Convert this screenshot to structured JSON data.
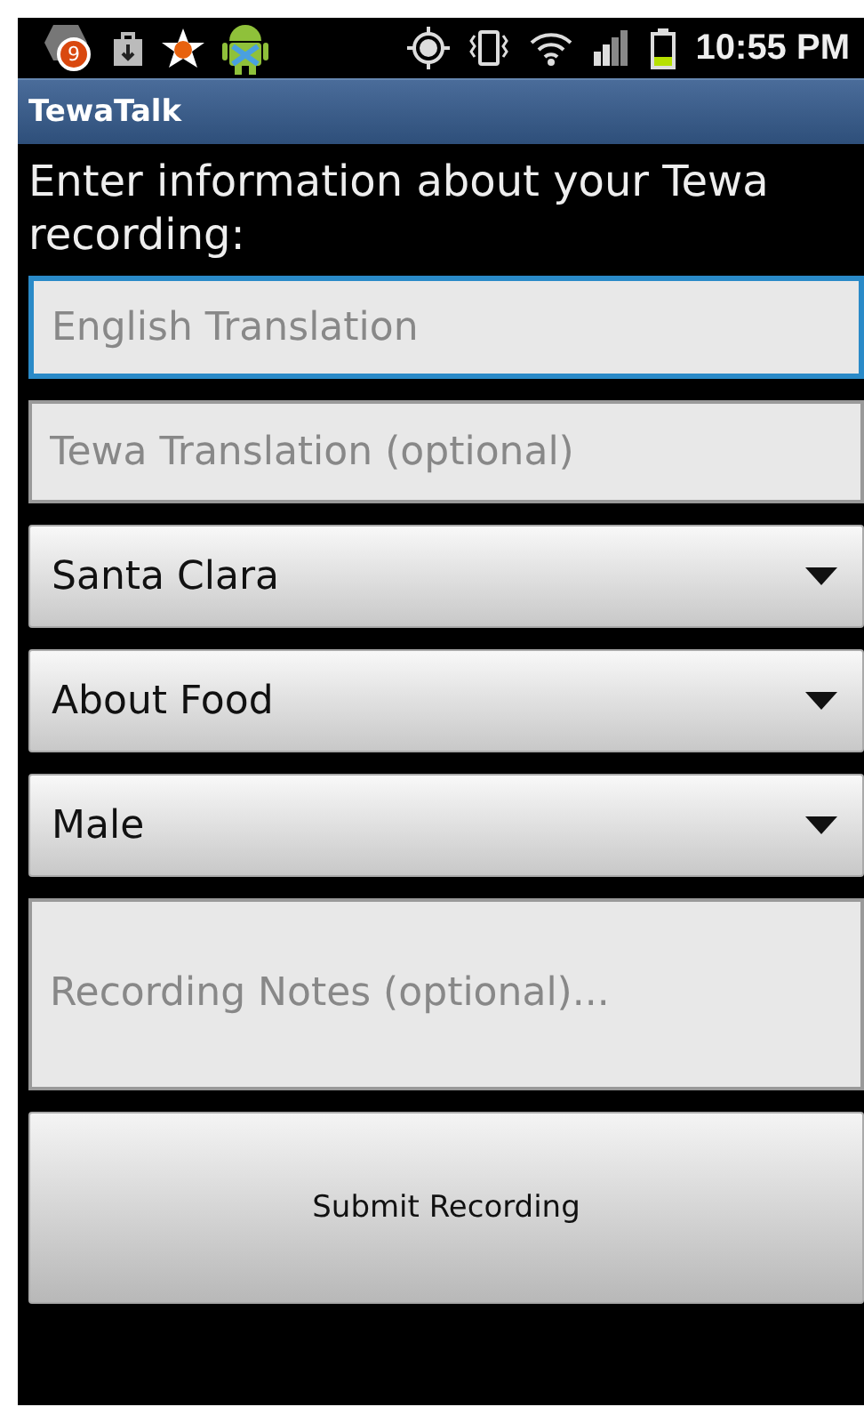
{
  "status_bar": {
    "notification_count": "9",
    "time": "10:55 PM"
  },
  "title_bar": {
    "title": "TewaTalk"
  },
  "heading": "Enter information about your Tewa recording:",
  "fields": [
    {
      "kind": "text",
      "placeholder": "English Translation",
      "focused": true
    },
    {
      "kind": "text",
      "placeholder": "Tewa Translation (optional)",
      "focused": false
    },
    {
      "kind": "spinner",
      "value": "Santa Clara"
    },
    {
      "kind": "spinner",
      "value": "About Food"
    },
    {
      "kind": "spinner",
      "value": "Male"
    },
    {
      "kind": "multiline",
      "placeholder": "Recording Notes (optional)..."
    },
    {
      "kind": "button",
      "label": "Submit Recording"
    }
  ]
}
